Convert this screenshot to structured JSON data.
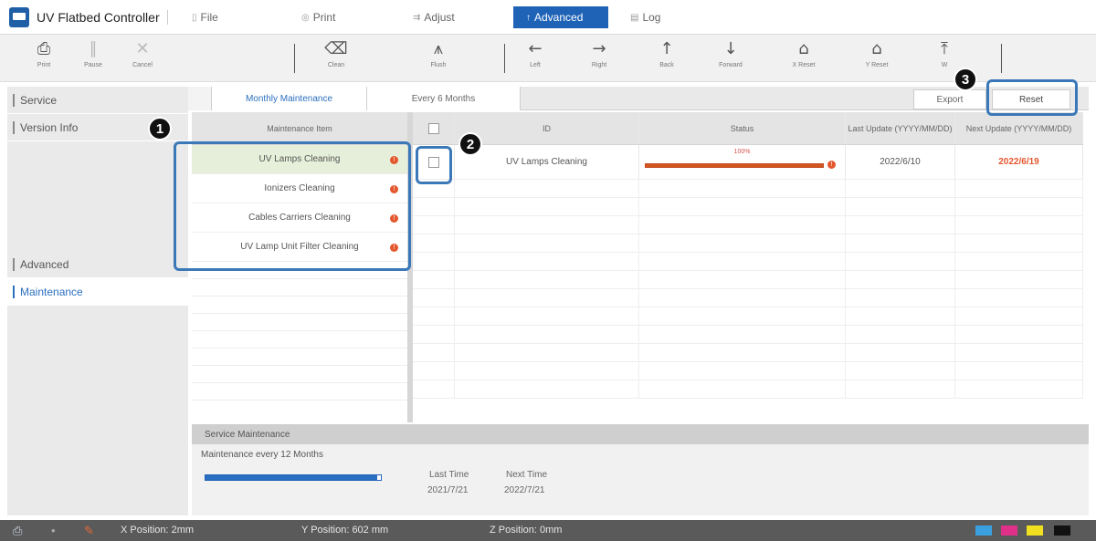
{
  "app": {
    "title": "UV Flatbed Controller"
  },
  "menu": {
    "items": [
      {
        "label": "File",
        "icon": "file-icon"
      },
      {
        "label": "Print",
        "icon": "print-icon"
      },
      {
        "label": "Adjust",
        "icon": "adjust-icon"
      },
      {
        "label": "Advanced",
        "icon": "advanced-icon",
        "active": true
      },
      {
        "label": "Log",
        "icon": "log-icon"
      }
    ]
  },
  "toolbar": {
    "print": "Print",
    "pause": "Pause",
    "cancel": "Cancel",
    "clean": "Clean",
    "flush": "Flush",
    "left": "Left",
    "right": "Right",
    "back": "Back",
    "forward": "Forward",
    "x_reset": "X Reset",
    "y_reset": "Y Reset",
    "w": "W"
  },
  "sidebar": {
    "items": [
      "Service",
      "Version Info",
      "Advanced",
      "Maintenance"
    ],
    "active": "Maintenance"
  },
  "tabs": {
    "monthly": "Monthly Maintenance",
    "six_months": "Every 6 Months"
  },
  "buttons": {
    "export": "Export",
    "reset": "Reset"
  },
  "maintenance_items": {
    "header": "Maintenance Item",
    "rows": [
      "UV Lamps Cleaning",
      "Ionizers Cleaning",
      "Cables Carriers Cleaning",
      "UV Lamp Unit Filter Cleaning"
    ]
  },
  "status_table": {
    "headers": {
      "id": "ID",
      "status": "Status",
      "last_update": "Last Update (YYYY/MM/DD)",
      "next_update": "Next Update (YYYY/MM/DD)"
    },
    "rows": [
      {
        "id": "UV Lamps Cleaning",
        "percent": "100%",
        "progress": 1.0,
        "last": "2022/6/10",
        "next": "2022/6/19"
      }
    ]
  },
  "service": {
    "header": "Service Maintenance",
    "label": "Maintenance every 12 Months",
    "progress": 0.98,
    "last_label": "Last Time",
    "last_value": "2021/7/21",
    "next_label": "Next Time",
    "next_value": "2022/7/21"
  },
  "statusbar": {
    "x": "X Position: 2mm",
    "y": "Y Position: 602 mm",
    "z": "Z Position: 0mm"
  },
  "ink_colors": [
    "#3aa0e0",
    "#e0308a",
    "#f0e020",
    "#111111"
  ],
  "callouts": [
    "1",
    "2",
    "3"
  ]
}
